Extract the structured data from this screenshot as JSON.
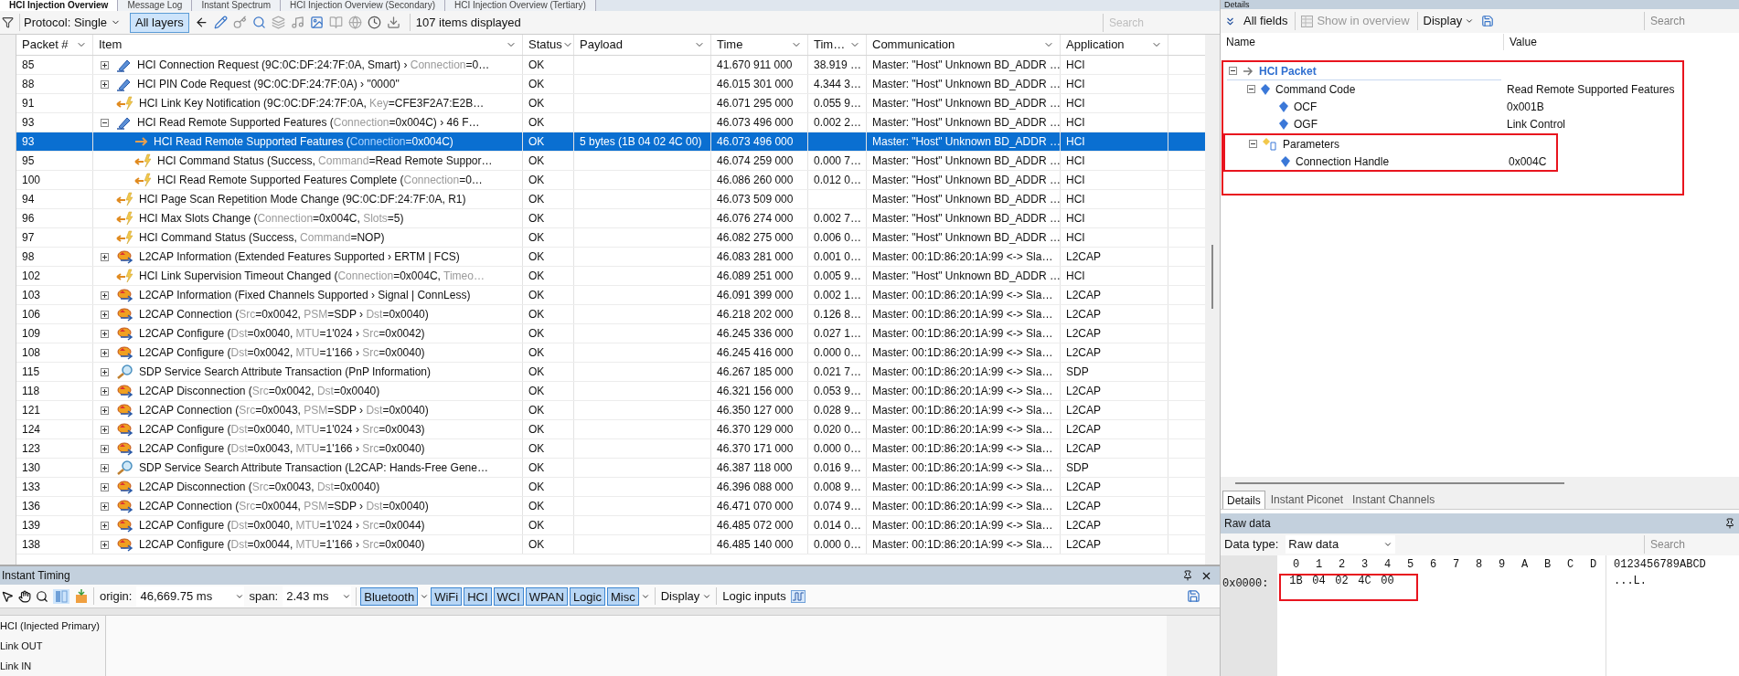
{
  "top_tabs": [
    {
      "label": "HCI Injection Overview",
      "selected": true
    },
    {
      "label": "Message Log",
      "selected": false
    },
    {
      "label": "Instant Spectrum",
      "selected": false
    },
    {
      "label": "HCI Injection Overview (Secondary)",
      "selected": false
    },
    {
      "label": "HCI Injection Overview (Tertiary)",
      "selected": false
    }
  ],
  "toolbar": {
    "protocol": "Protocol: Single",
    "layers": {
      "label": "All layers",
      "selected": true
    },
    "status": "107 items displayed",
    "search_placeholder": "Search"
  },
  "table": {
    "columns": [
      "Packet #",
      "Item",
      "Status",
      "Payload",
      "Time",
      "Tim…",
      "Communication",
      "Application"
    ],
    "rows": [
      {
        "packet": "85",
        "kind": "hci-command",
        "expanded": false,
        "selected": false,
        "item": [
          "HCI Connection Request (9C:0C:DF:24:7F:0A, Smart) › ",
          "Connection",
          "=0…"
        ],
        "status": "OK",
        "time": "41.670 911 000",
        "delta": "38.919 …",
        "communication": "Master: \"Host\" Unknown BD_ADDR …",
        "application": "HCI"
      },
      {
        "packet": "88",
        "kind": "hci-command",
        "expanded": false,
        "selected": false,
        "item": [
          "HCI PIN Code Request (9C:0C:DF:24:7F:0A) › \"0000\""
        ],
        "status": "OK",
        "time": "46.015 301 000",
        "delta": "4.344 3…",
        "communication": "Master: \"Host\" Unknown BD_ADDR …",
        "application": "HCI"
      },
      {
        "packet": "91",
        "kind": "hci-event",
        "selected": false,
        "item": [
          "HCI Link Key Notification (9C:0C:DF:24:7F:0A, ",
          "Key",
          "=CFE3F2A7:E2B…"
        ],
        "status": "OK",
        "time": "46.071 295 000",
        "delta": "0.055 9…",
        "communication": "Master: \"Host\" Unknown BD_ADDR …",
        "application": "HCI"
      },
      {
        "packet": "93",
        "kind": "hci-command",
        "expanded": true,
        "selected": false,
        "item": [
          "HCI Read Remote Supported Features (",
          "Connection",
          "=0x004C) › 46 F…"
        ],
        "status": "OK",
        "time": "46.073 496 000",
        "delta": "0.002 2…",
        "communication": "Master: \"Host\" Unknown BD_ADDR …",
        "application": "HCI",
        "children": [
          {
            "packet": "93",
            "kind": "packet",
            "selected": true,
            "item": [
              "HCI Read Remote Supported Features (",
              "Connection",
              "=0x004C)"
            ],
            "status": "OK",
            "payload": "5 bytes (1B 04 02 4C 00)",
            "time": "46.073 496 000",
            "communication": "Master: \"Host\" Unknown BD_ADDR …",
            "application": "HCI"
          },
          {
            "packet": "95",
            "kind": "hci-event",
            "selected": false,
            "item": [
              "HCI Command Status (Success, ",
              "Command",
              "=Read Remote Suppor…"
            ],
            "status": "OK",
            "time": "46.074 259 000",
            "delta": "0.000 7…",
            "communication": "Master: \"Host\" Unknown BD_ADDR …",
            "application": "HCI"
          },
          {
            "packet": "100",
            "kind": "hci-event",
            "selected": false,
            "item": [
              "HCI Read Remote Supported Features Complete (",
              "Connection",
              "=0…"
            ],
            "status": "OK",
            "time": "46.086 260 000",
            "delta": "0.012 0…",
            "communication": "Master: \"Host\" Unknown BD_ADDR …",
            "application": "HCI"
          }
        ]
      },
      {
        "packet": "94",
        "kind": "hci-event",
        "selected": false,
        "item": [
          "HCI Page Scan Repetition Mode Change (9C:0C:DF:24:7F:0A, R1)"
        ],
        "status": "OK",
        "time": "46.073 509 000",
        "communication": "Master: \"Host\" Unknown BD_ADDR …",
        "application": "HCI"
      },
      {
        "packet": "96",
        "kind": "hci-event",
        "selected": false,
        "item": [
          "HCI Max Slots Change (",
          "Connection",
          "=0x004C, ",
          "Slots",
          "=5)"
        ],
        "status": "OK",
        "time": "46.076 274 000",
        "delta": "0.002 7…",
        "communication": "Master: \"Host\" Unknown BD_ADDR …",
        "application": "HCI"
      },
      {
        "packet": "97",
        "kind": "hci-event",
        "selected": false,
        "item": [
          "HCI Command Status (Success, ",
          "Command",
          "=NOP)"
        ],
        "status": "OK",
        "time": "46.082 275 000",
        "delta": "0.006 0…",
        "communication": "Master: \"Host\" Unknown BD_ADDR …",
        "application": "HCI"
      },
      {
        "packet": "98",
        "kind": "l2cap",
        "expanded": false,
        "selected": false,
        "item": [
          "L2CAP Information (Extended Features Supported › ERTM | FCS)"
        ],
        "status": "OK",
        "time": "46.083 281 000",
        "delta": "0.001 0…",
        "communication": "Master: 00:1D:86:20:1A:99 <-> Sla…",
        "application": "L2CAP"
      },
      {
        "packet": "102",
        "kind": "hci-event",
        "selected": false,
        "item": [
          "HCI Link Supervision Timeout Changed (",
          "Connection",
          "=0x004C, ",
          "Timeo…"
        ],
        "status": "OK",
        "time": "46.089 251 000",
        "delta": "0.005 9…",
        "communication": "Master: \"Host\" Unknown BD_ADDR …",
        "application": "HCI"
      },
      {
        "packet": "103",
        "kind": "l2cap",
        "expanded": false,
        "selected": false,
        "item": [
          "L2CAP Information (Fixed Channels Supported › Signal | ConnLess)"
        ],
        "status": "OK",
        "time": "46.091 399 000",
        "delta": "0.002 1…",
        "communication": "Master: 00:1D:86:20:1A:99 <-> Sla…",
        "application": "L2CAP"
      },
      {
        "packet": "106",
        "kind": "l2cap",
        "expanded": false,
        "selected": false,
        "item": [
          "L2CAP Connection (",
          "Src",
          "=0x0042, ",
          "PSM",
          "=SDP › ",
          "Dst",
          "=0x0040)"
        ],
        "status": "OK",
        "time": "46.218 202 000",
        "delta": "0.126 8…",
        "communication": "Master: 00:1D:86:20:1A:99 <-> Sla…",
        "application": "L2CAP"
      },
      {
        "packet": "109",
        "kind": "l2cap",
        "expanded": false,
        "selected": false,
        "item": [
          "L2CAP Configure (",
          "Dst",
          "=0x0040, ",
          "MTU",
          "=1'024 › ",
          "Src",
          "=0x0042)"
        ],
        "status": "OK",
        "time": "46.245 336 000",
        "delta": "0.027 1…",
        "communication": "Master: 00:1D:86:20:1A:99 <-> Sla…",
        "application": "L2CAP"
      },
      {
        "packet": "108",
        "kind": "l2cap",
        "expanded": false,
        "selected": false,
        "item": [
          "L2CAP Configure (",
          "Dst",
          "=0x0042, ",
          "MTU",
          "=1'166 › ",
          "Src",
          "=0x0040)"
        ],
        "status": "OK",
        "time": "46.245 416 000",
        "delta": "0.000 0…",
        "communication": "Master: 00:1D:86:20:1A:99 <-> Sla…",
        "application": "L2CAP"
      },
      {
        "packet": "115",
        "kind": "sdp",
        "expanded": false,
        "selected": false,
        "item": [
          "SDP Service Search Attribute Transaction (PnP Information)"
        ],
        "status": "OK",
        "time": "46.267 185 000",
        "delta": "0.021 7…",
        "communication": "Master: 00:1D:86:20:1A:99 <-> Sla…",
        "application": "SDP"
      },
      {
        "packet": "118",
        "kind": "l2cap",
        "expanded": false,
        "selected": false,
        "item": [
          "L2CAP Disconnection (",
          "Src",
          "=0x0042, ",
          "Dst",
          "=0x0040)"
        ],
        "status": "OK",
        "time": "46.321 156 000",
        "delta": "0.053 9…",
        "communication": "Master: 00:1D:86:20:1A:99 <-> Sla…",
        "application": "L2CAP"
      },
      {
        "packet": "121",
        "kind": "l2cap",
        "expanded": false,
        "selected": false,
        "item": [
          "L2CAP Connection (",
          "Src",
          "=0x0043, ",
          "PSM",
          "=SDP › ",
          "Dst",
          "=0x0040)"
        ],
        "status": "OK",
        "time": "46.350 127 000",
        "delta": "0.028 9…",
        "communication": "Master: 00:1D:86:20:1A:99 <-> Sla…",
        "application": "L2CAP"
      },
      {
        "packet": "124",
        "kind": "l2cap",
        "expanded": false,
        "selected": false,
        "item": [
          "L2CAP Configure (",
          "Dst",
          "=0x0040, ",
          "MTU",
          "=1'024 › ",
          "Src",
          "=0x0043)"
        ],
        "status": "OK",
        "time": "46.370 129 000",
        "delta": "0.020 0…",
        "communication": "Master: 00:1D:86:20:1A:99 <-> Sla…",
        "application": "L2CAP"
      },
      {
        "packet": "123",
        "kind": "l2cap",
        "expanded": false,
        "selected": false,
        "item": [
          "L2CAP Configure (",
          "Dst",
          "=0x0043, ",
          "MTU",
          "=1'166 › ",
          "Src",
          "=0x0040)"
        ],
        "status": "OK",
        "time": "46.370 171 000",
        "delta": "0.000 0…",
        "communication": "Master: 00:1D:86:20:1A:99 <-> Sla…",
        "application": "L2CAP"
      },
      {
        "packet": "130",
        "kind": "sdp",
        "expanded": false,
        "selected": false,
        "item": [
          "SDP Service Search Attribute Transaction (L2CAP: Hands-Free Gene…"
        ],
        "status": "OK",
        "time": "46.387 118 000",
        "delta": "0.016 9…",
        "communication": "Master: 00:1D:86:20:1A:99 <-> Sla…",
        "application": "SDP"
      },
      {
        "packet": "133",
        "kind": "l2cap",
        "expanded": false,
        "selected": false,
        "item": [
          "L2CAP Disconnection (",
          "Src",
          "=0x0043, ",
          "Dst",
          "=0x0040)"
        ],
        "status": "OK",
        "time": "46.396 088 000",
        "delta": "0.008 9…",
        "communication": "Master: 00:1D:86:20:1A:99 <-> Sla…",
        "application": "L2CAP"
      },
      {
        "packet": "136",
        "kind": "l2cap",
        "expanded": false,
        "selected": false,
        "item": [
          "L2CAP Connection (",
          "Src",
          "=0x0044, ",
          "PSM",
          "=SDP › ",
          "Dst",
          "=0x0040)"
        ],
        "status": "OK",
        "time": "46.471 070 000",
        "delta": "0.074 9…",
        "communication": "Master: 00:1D:86:20:1A:99 <-> Sla…",
        "application": "L2CAP"
      },
      {
        "packet": "139",
        "kind": "l2cap",
        "expanded": false,
        "selected": false,
        "item": [
          "L2CAP Configure (",
          "Dst",
          "=0x0040, ",
          "MTU",
          "=1'024 › ",
          "Src",
          "=0x0044)"
        ],
        "status": "OK",
        "time": "46.485 072 000",
        "delta": "0.014 0…",
        "communication": "Master: 00:1D:86:20:1A:99 <-> Sla…",
        "application": "L2CAP"
      },
      {
        "packet": "138",
        "kind": "l2cap",
        "expanded": false,
        "selected": false,
        "item": [
          "L2CAP Configure (",
          "Dst",
          "=0x0044, ",
          "MTU",
          "=1'166 › ",
          "Src",
          "=0x0040)"
        ],
        "status": "OK",
        "time": "46.485 140 000",
        "delta": "0.000 0…",
        "communication": "Master: 00:1D:86:20:1A:99 <-> Sla…",
        "application": "L2CAP"
      }
    ]
  },
  "timing": {
    "title": "Instant Timing",
    "origin_label": "origin:",
    "origin": "46,669.75 ms",
    "span_label": "span:",
    "span": "2.43 ms",
    "filters": [
      {
        "label": "Bluetooth",
        "selected": true
      },
      {
        "label": "WiFi",
        "selected": true
      },
      {
        "label": "HCI",
        "selected": true
      },
      {
        "label": "WCI",
        "selected": true
      },
      {
        "label": "WPAN",
        "selected": true
      },
      {
        "label": "Logic",
        "selected": true
      },
      {
        "label": "Misc",
        "selected": true
      }
    ],
    "display": "Display",
    "logic_inputs": "Logic inputs",
    "lanes": [
      "HCI (Injected Primary)",
      "Link OUT",
      "Link IN"
    ]
  },
  "details": {
    "title": "Details",
    "all_fields": "All fields",
    "show_in_overview": {
      "label": "Show in overview",
      "disabled": true
    },
    "display": "Display",
    "search_placeholder": "Search",
    "columns": [
      "Name",
      "Value"
    ],
    "tree": [
      {
        "kind": "header",
        "name": "HCI Packet",
        "expanded": true,
        "highlighted": true,
        "children": [
          {
            "kind": "field",
            "name": "Command Code",
            "value": "Read Remote Supported Features",
            "expanded": true,
            "highlighted": false,
            "children": [
              {
                "kind": "field",
                "name": "OCF",
                "value": "0x001B",
                "highlighted": false
              },
              {
                "kind": "field",
                "name": "OGF",
                "value": "Link Control",
                "highlighted": false
              }
            ]
          },
          {
            "kind": "group",
            "name": "Parameters",
            "expanded": true,
            "highlighted": true,
            "children": [
              {
                "kind": "field",
                "name": "Connection Handle",
                "value": "0x004C",
                "highlighted": false
              }
            ]
          }
        ]
      }
    ],
    "tabs": [
      {
        "label": "Details",
        "selected": true
      },
      {
        "label": "Instant Piconet",
        "selected": false
      },
      {
        "label": "Instant Channels",
        "selected": false
      }
    ]
  },
  "raw_data": {
    "title": "Raw data",
    "data_type_label": "Data type:",
    "data_type": "Raw data",
    "search_placeholder": "Search",
    "columns": [
      "0",
      "1",
      "2",
      "3",
      "4",
      "5",
      "6",
      "7",
      "8",
      "9",
      "A",
      "B",
      "C",
      "D"
    ],
    "offset": "0x0000:",
    "bytes": [
      "1B",
      "04",
      "02",
      "4C",
      "00"
    ],
    "highlighted": true,
    "ascii_header": "0123456789ABCD",
    "ascii": "...L."
  }
}
